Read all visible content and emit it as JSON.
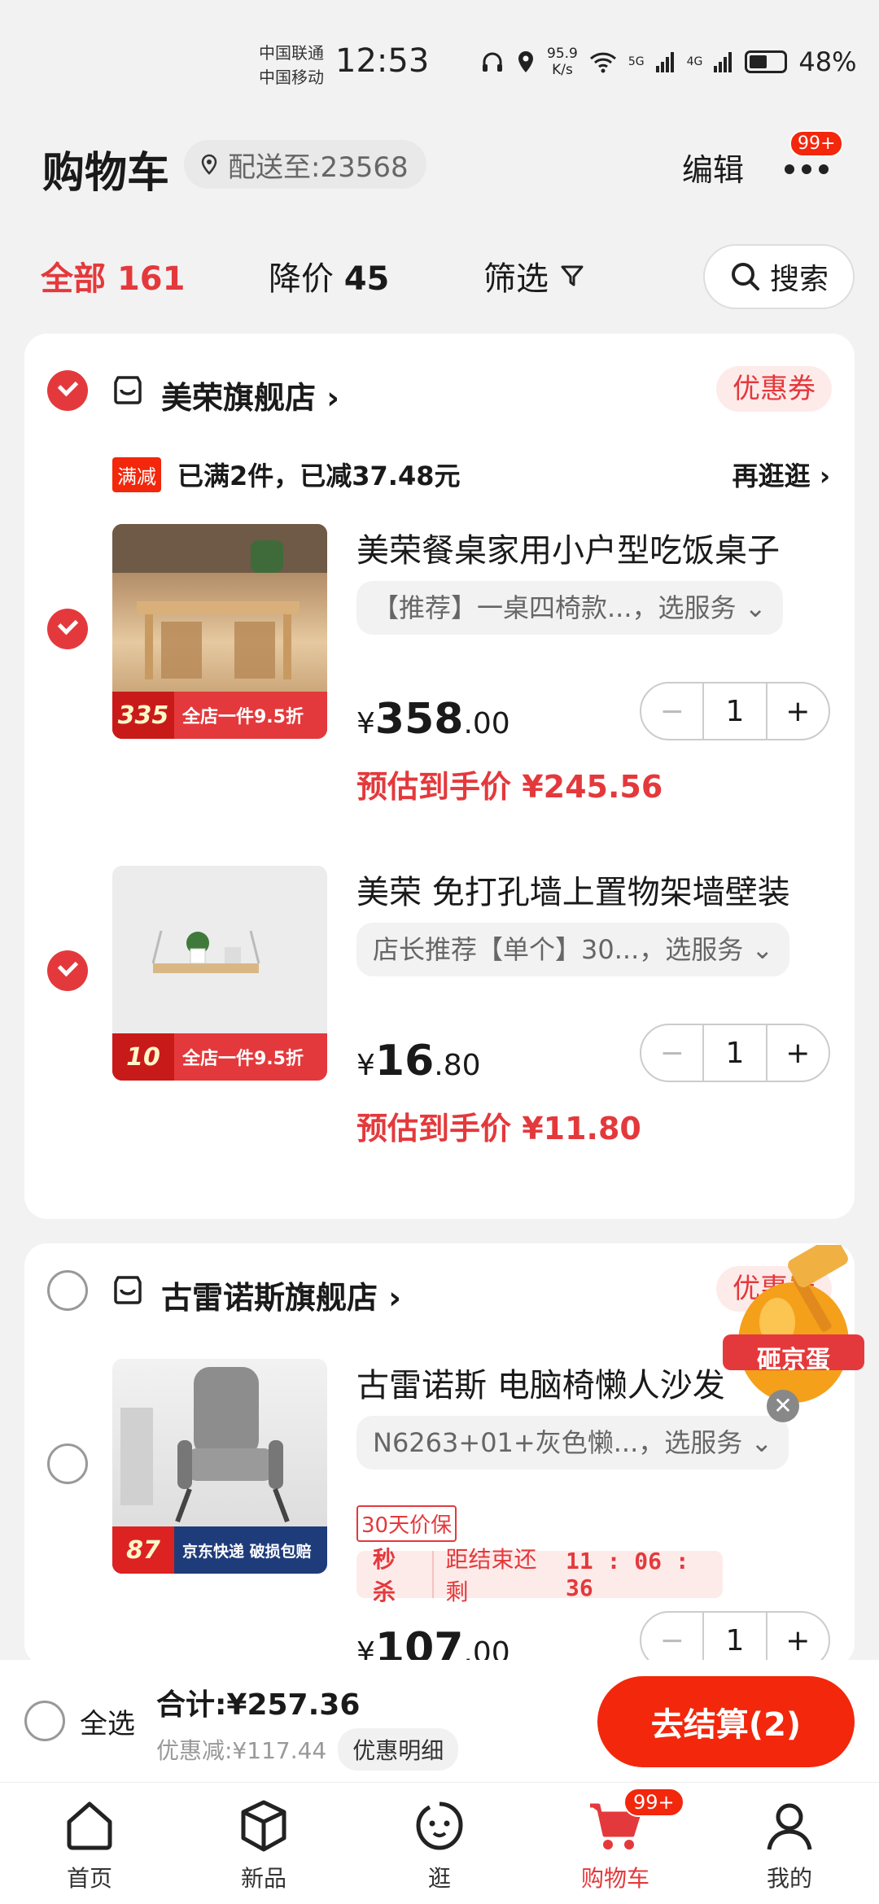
{
  "status_bar": {
    "carrier_1": "中国联通",
    "carrier_2": "中国移动",
    "time": "12:53",
    "speed": "95.9",
    "speed_unit": "K/s",
    "net_1": "5G",
    "net_2": "4G",
    "battery": "48%"
  },
  "header": {
    "title": "购物车",
    "address": "配送至:23568",
    "edit_label": "编辑",
    "more_badge": "99+"
  },
  "filters": {
    "all_label": "全部",
    "all_count": "161",
    "drop_label": "降价",
    "drop_count": "45",
    "filter_label": "筛选",
    "search_label": "搜索"
  },
  "stores": [
    {
      "name": "美荣旗舰店",
      "coupon": "优惠券",
      "promo_tag": "满减",
      "promo_text": "已满2件，已减37.48元",
      "promo_more": "再逛逛",
      "items": [
        {
          "title": "美荣餐桌家用小户型吃饭桌子",
          "spec": "【推荐】一桌四椅款...，选服务",
          "price_int": "358",
          "price_dec": ".00",
          "estimate": "预估到手价 ¥245.56",
          "qty": "1",
          "thumb_price": "335",
          "thumb_text": "全店一件9.5折"
        },
        {
          "title": "美荣 免打孔墙上置物架墙壁装",
          "spec": "店长推荐【单个】30...，选服务",
          "price_int": "16",
          "price_dec": ".80",
          "estimate": "预估到手价 ¥11.80",
          "qty": "1",
          "thumb_price": "10",
          "thumb_text": "全店一件9.5折"
        }
      ]
    },
    {
      "name": "古雷诺斯旗舰店",
      "coupon": "优惠券",
      "items": [
        {
          "title": "古雷诺斯 电脑椅懒人沙发",
          "spec": "N6263+01+灰色懒...，选服务",
          "guarantee": "30天价保",
          "seckill": "秒杀",
          "seckill_left": "距结束还剩",
          "countdown": "11 : 06 : 36",
          "price_int": "107",
          "price_dec": ".00",
          "qty": "1",
          "thumb_price": "87",
          "thumb_text": "京东快递  破损包赔"
        }
      ]
    }
  ],
  "egg_label": "砸京蛋",
  "checkout": {
    "select_all": "全选",
    "total": "合计:¥257.36",
    "saved": "优惠减:¥117.44",
    "detail": "优惠明细",
    "pay": "去结算(2)"
  },
  "tabs": [
    {
      "label": "首页"
    },
    {
      "label": "新品"
    },
    {
      "label": "逛"
    },
    {
      "label": "购物车",
      "badge": "99+"
    },
    {
      "label": "我的"
    }
  ],
  "currency": "¥",
  "colors": {
    "accent": "#e4393c",
    "brand_red": "#f2270c"
  }
}
